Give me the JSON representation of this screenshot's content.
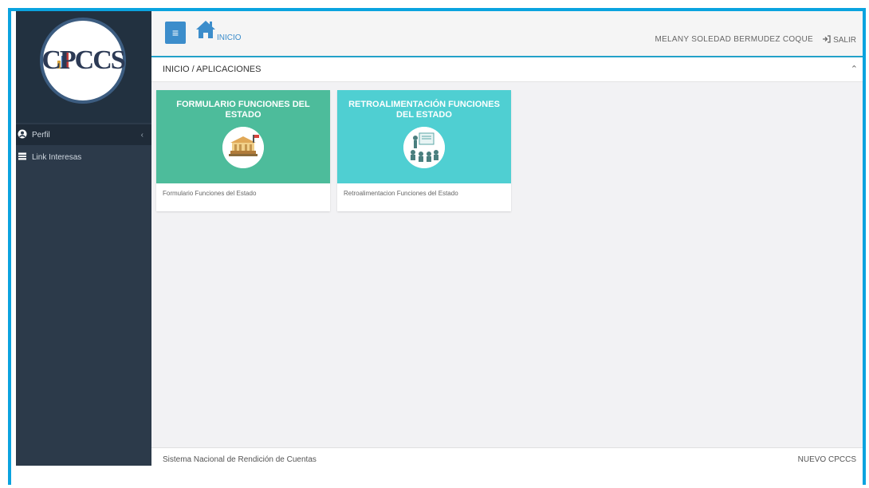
{
  "sidebar": {
    "logo": {
      "text": "CPCCS"
    },
    "items": [
      {
        "label": "Perfil",
        "icon": "user-circle-icon",
        "active": true
      },
      {
        "label": "Link Interesas",
        "icon": "book-icon",
        "active": false
      }
    ]
  },
  "header": {
    "menu_icon": "hamburger-icon",
    "home_label": "INICIO",
    "user_name": "MELANY SOLEDAD BERMUDEZ COQUE",
    "logout_label": "SALIR"
  },
  "breadcrumb": {
    "text": "INICIO / APLICACIONES"
  },
  "apps": [
    {
      "title": "FORMULARIO FUNCIONES DEL ESTADO",
      "description": "Formulario Funciones del Estado",
      "color": "#4dbc9b",
      "icon": "building-icon"
    },
    {
      "title": "RETROALIMENTACIÓN FUNCIONES DEL ESTADO",
      "description": "Retroalimentacion Funciones del Estado",
      "color": "#4fcfd2",
      "icon": "presentation-icon"
    }
  ],
  "footer": {
    "left": "Sistema Nacional de Rendición de Cuentas",
    "right": "NUEVO CPCCS"
  },
  "colors": {
    "accent": "#0aa3df",
    "sidebar": "#2c3a4a",
    "primary_button": "#3c8dcb"
  }
}
